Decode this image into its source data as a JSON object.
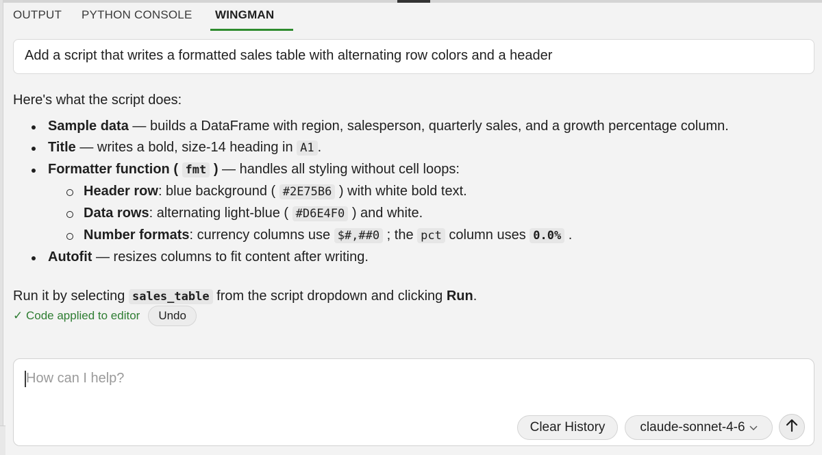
{
  "tabs": {
    "output": "OUTPUT",
    "python_console": "PYTHON CONSOLE",
    "wingman": "WINGMAN"
  },
  "prompt": "Add a script that writes a formatted sales table with alternating row colors and a header",
  "response": {
    "intro": "Here's what the script does:",
    "b1": {
      "title": "Sample data",
      "text": " — builds a DataFrame with region, salesperson, quarterly sales, and a growth percentage column."
    },
    "b2": {
      "title": "Title",
      "text1": " — writes a bold, size-14 heading in ",
      "code": "A1",
      "text2": "."
    },
    "b3": {
      "title": "Formatter function ( ",
      "code": "fmt",
      "title_end": " )",
      "text": " — handles all styling without cell loops:"
    },
    "s1": {
      "title": "Header row",
      "text1": ": blue background ( ",
      "code": "#2E75B6",
      "text2": " ) with white bold text."
    },
    "s2": {
      "title": "Data rows",
      "text1": ": alternating light-blue ( ",
      "code": "#D6E4F0",
      "text2": " ) and white."
    },
    "s3": {
      "title": "Number formats",
      "text1": ": currency columns use ",
      "code1": "$#,##0",
      "text2": " ; the ",
      "code2": "pct",
      "text3": " column uses ",
      "code3": "0.0%",
      "text4": " ."
    },
    "b4": {
      "title": "Autofit",
      "text": " — resizes columns to fit content after writing."
    },
    "run": {
      "text1": "Run it by selecting ",
      "code": "sales_table",
      "text2": " from the script dropdown and clicking ",
      "bold": "Run",
      "text3": "."
    }
  },
  "status": {
    "applied": "✓ Code applied to editor",
    "undo": "Undo"
  },
  "input": {
    "placeholder": "How can I help?"
  },
  "buttons": {
    "clear": "Clear History",
    "model": "claude-sonnet-4-6",
    "model_chevron": "chevron-down-icon",
    "send": "arrow-up-icon"
  },
  "colors": {
    "accent": "#2e8b2e",
    "applied_text": "#2e7d32"
  }
}
